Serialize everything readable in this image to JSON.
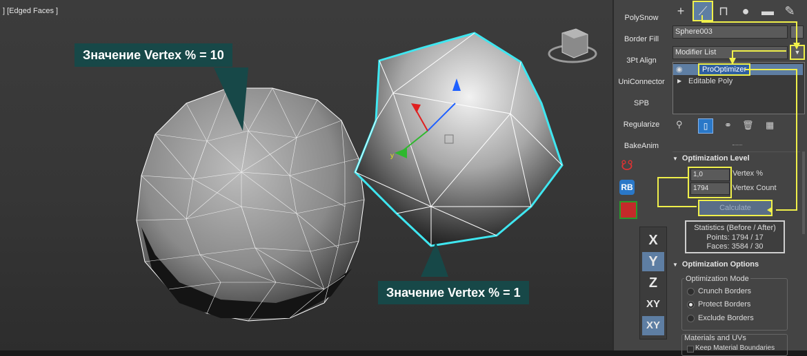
{
  "viewport": {
    "label": "] [Edged Faces ]",
    "callout_left": "Значение Vertex % = 10",
    "callout_right": "Значение Vertex % = 1"
  },
  "toolbar": {
    "buttons": [
      "PolySnow",
      "Border Fill",
      "3Pt Align",
      "UniConnector",
      "SPB",
      "Regularize",
      "BakeAnim"
    ],
    "rb_label": "RB",
    "axes": [
      "X",
      "Y",
      "Z",
      "XY",
      "XY"
    ]
  },
  "panel": {
    "tab_icons": [
      "plus-icon",
      "curve-icon",
      "hierarchy-icon",
      "motion-icon",
      "display-icon",
      "wrench-icon"
    ],
    "object_name": "Sphere003",
    "modifier_list": "Modifier List",
    "dropdown_arrow": "▼",
    "modifiers": [
      "ProOptimizer",
      "Editable Poly"
    ],
    "optimization_level": {
      "title": "Optimization Level",
      "vertex_percent_value": "1,0",
      "vertex_percent_label": "Vertex %",
      "vertex_count_value": "1794",
      "vertex_count_label": "Vertex Count",
      "calculate": "Calculate"
    },
    "statistics": {
      "title": "Statistics (Before / After)",
      "points": "Points: 1794 / 17",
      "faces": "Faces: 3584 / 30"
    },
    "optimization_options": {
      "title": "Optimization Options",
      "mode_title": "Optimization Mode",
      "modes": [
        "Crunch Borders",
        "Protect Borders",
        "Exclude Borders"
      ],
      "selected_mode": "Protect Borders",
      "materials_title": "Materials and UVs",
      "keep_material": "Keep Material Boundaries"
    }
  },
  "colors": {
    "highlight": "#f0f04a",
    "callout": "#174848",
    "selection": "#3fe6f0"
  }
}
